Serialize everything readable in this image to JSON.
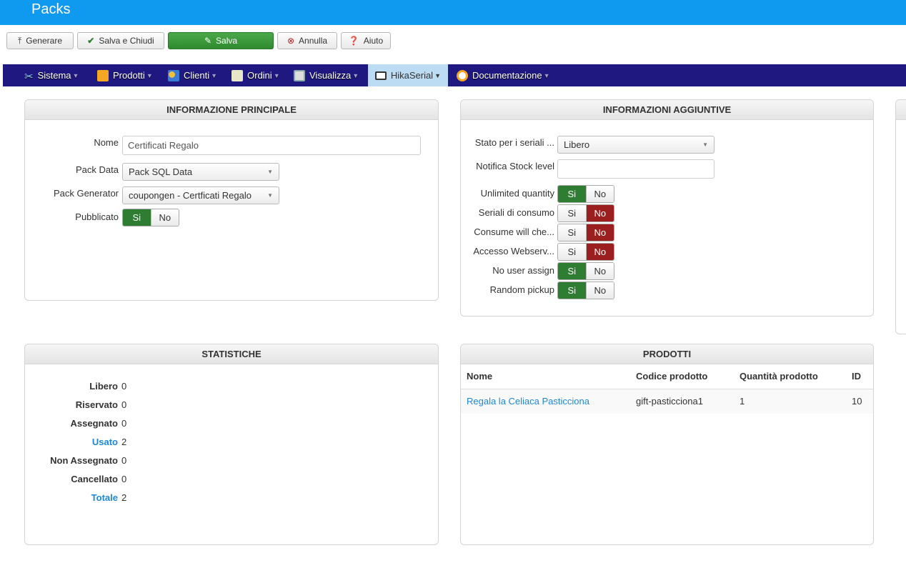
{
  "header": {
    "title": "Packs"
  },
  "toolbar": {
    "generate": "Generare",
    "save_close": "Salva e Chiudi",
    "save": "Salva",
    "cancel": "Annulla",
    "help": "Aiuto"
  },
  "nav": {
    "items": [
      {
        "label": "Sistema",
        "icon": "tools-icon"
      },
      {
        "label": "Prodotti",
        "icon": "box-icon"
      },
      {
        "label": "Clienti",
        "icon": "users-icon"
      },
      {
        "label": "Ordini",
        "icon": "orders-icon"
      },
      {
        "label": "Visualizza",
        "icon": "display-icon"
      },
      {
        "label": "HikaSerial",
        "icon": "serial-icon",
        "active": true
      },
      {
        "label": "Documentazione",
        "icon": "lifebuoy-icon"
      }
    ]
  },
  "main_info": {
    "title": "INFORMAZIONE PRINCIPALE",
    "name_label": "Nome",
    "name_value": "Certificati Regalo",
    "pack_data_label": "Pack Data",
    "pack_data_value": "Pack SQL Data",
    "pack_generator_label": "Pack Generator",
    "pack_generator_value": "coupongen - Certficati Regalo",
    "published_label": "Pubblicato",
    "published": true
  },
  "extra_info": {
    "title": "INFORMAZIONI AGGIUNTIVE",
    "state_label": "Stato per i seriali ...",
    "state_value": "Libero",
    "stock_label": "Notifica Stock level",
    "stock_value": "",
    "toggles": [
      {
        "label": "Unlimited quantity",
        "value": true
      },
      {
        "label": "Seriali di consumo",
        "value": false
      },
      {
        "label": "Consume will che...",
        "value": false
      },
      {
        "label": "Accesso Webserv...",
        "value": false
      },
      {
        "label": "No user assign",
        "value": true
      },
      {
        "label": "Random pickup",
        "value": true
      }
    ]
  },
  "toggle_labels": {
    "yes": "Si",
    "no": "No"
  },
  "stats": {
    "title": "STATISTICHE",
    "rows": [
      {
        "label": "Libero",
        "value": "0"
      },
      {
        "label": "Riservato",
        "value": "0"
      },
      {
        "label": "Assegnato",
        "value": "0"
      },
      {
        "label": "Usato",
        "value": "2",
        "link": true
      },
      {
        "label": "Non Assegnato",
        "value": "0"
      },
      {
        "label": "Cancellato",
        "value": "0"
      },
      {
        "label": "Totale",
        "value": "2",
        "link": true
      }
    ]
  },
  "products": {
    "title": "PRODOTTI",
    "columns": [
      "Nome",
      "Codice prodotto",
      "Quantità prodotto",
      "ID"
    ],
    "rows": [
      {
        "name": "Regala la Celiaca Pasticciona",
        "code": "gift-pasticciona1",
        "qty": "1",
        "id": "10"
      }
    ]
  },
  "colors": {
    "header": "#0f9af0",
    "nav": "#1f1880",
    "yes_active": "#2f7d32",
    "no_active": "#9c1f1f",
    "link": "#1e88d8"
  }
}
